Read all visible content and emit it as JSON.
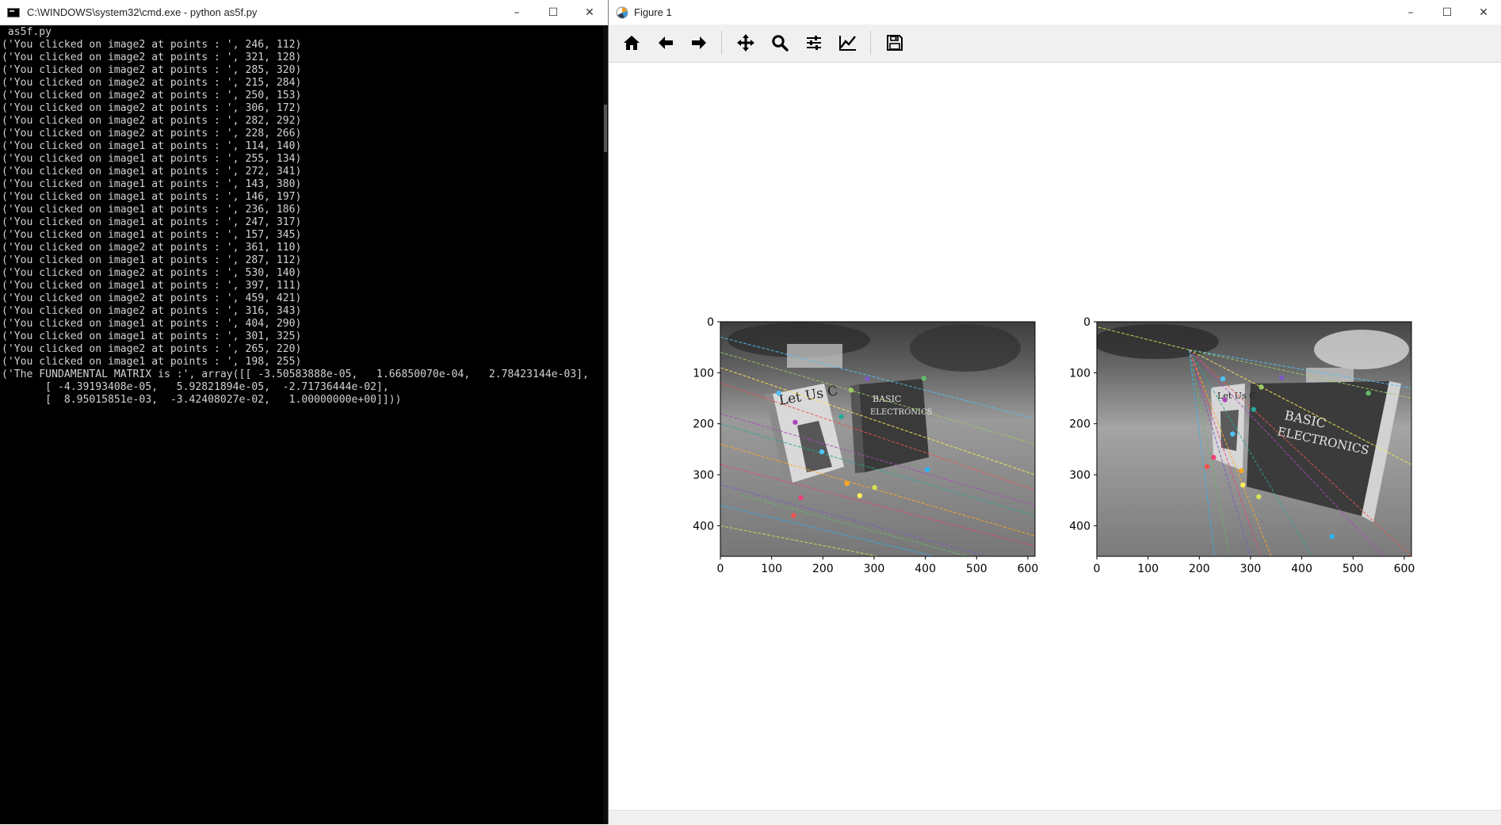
{
  "cmd_window": {
    "title": "C:\\WINDOWS\\system32\\cmd.exe - python  as5f.py",
    "buttons": {
      "minimize": "–",
      "maximize": "☐",
      "close": "✕"
    },
    "lines": [
      " as5f.py",
      "('You clicked on image2 at points : ', 246, 112)",
      "('You clicked on image2 at points : ', 321, 128)",
      "('You clicked on image2 at points : ', 285, 320)",
      "('You clicked on image2 at points : ', 215, 284)",
      "('You clicked on image2 at points : ', 250, 153)",
      "('You clicked on image2 at points : ', 306, 172)",
      "('You clicked on image2 at points : ', 282, 292)",
      "('You clicked on image2 at points : ', 228, 266)",
      "('You clicked on image1 at points : ', 114, 140)",
      "('You clicked on image1 at points : ', 255, 134)",
      "('You clicked on image1 at points : ', 272, 341)",
      "('You clicked on image1 at points : ', 143, 380)",
      "('You clicked on image1 at points : ', 146, 197)",
      "('You clicked on image1 at points : ', 236, 186)",
      "('You clicked on image1 at points : ', 247, 317)",
      "('You clicked on image1 at points : ', 157, 345)",
      "('You clicked on image2 at points : ', 361, 110)",
      "('You clicked on image1 at points : ', 287, 112)",
      "('You clicked on image2 at points : ', 530, 140)",
      "('You clicked on image1 at points : ', 397, 111)",
      "('You clicked on image2 at points : ', 459, 421)",
      "('You clicked on image2 at points : ', 316, 343)",
      "('You clicked on image1 at points : ', 404, 290)",
      "('You clicked on image1 at points : ', 301, 325)",
      "('You clicked on image2 at points : ', 265, 220)",
      "('You clicked on image1 at points : ', 198, 255)",
      "('The FUNDAMENTAL MATRIX is :', array([[ -3.50583888e-05,   1.66850070e-04,   2.78423144e-03],",
      "       [ -4.39193408e-05,   5.92821894e-05,  -2.71736444e-02],",
      "       [  8.95015851e-03,  -3.42408027e-02,   1.00000000e+00]]))"
    ]
  },
  "figure_window": {
    "title": "Figure 1",
    "buttons": {
      "minimize": "–",
      "maximize": "☐",
      "close": "✕"
    },
    "toolbar": [
      {
        "name": "home",
        "icon": "home-icon"
      },
      {
        "name": "back",
        "icon": "arrow-left-icon"
      },
      {
        "name": "forward",
        "icon": "arrow-right-icon"
      },
      {
        "name": "pan",
        "icon": "move-icon"
      },
      {
        "name": "zoom",
        "icon": "magnifier-icon"
      },
      {
        "name": "configure-subplots",
        "icon": "sliders-icon"
      },
      {
        "name": "edit-axes",
        "icon": "line-chart-icon"
      },
      {
        "name": "save",
        "icon": "floppy-disk-icon"
      }
    ],
    "plots": [
      {
        "id": "image1",
        "x_ticks": [
          "0",
          "100",
          "200",
          "300",
          "400",
          "500",
          "600"
        ],
        "y_ticks": [
          "0",
          "100",
          "200",
          "300",
          "400"
        ],
        "xlim": [
          0,
          614
        ],
        "ylim": [
          460,
          0
        ],
        "book_labels": [
          "Let Us C",
          "BASIC",
          "ELECTRONICS"
        ]
      },
      {
        "id": "image2",
        "x_ticks": [
          "0",
          "100",
          "200",
          "300",
          "400",
          "500",
          "600"
        ],
        "y_ticks": [
          "0",
          "100",
          "200",
          "300",
          "400"
        ],
        "xlim": [
          0,
          614
        ],
        "ylim": [
          460,
          0
        ],
        "book_labels": [
          "Let Us C",
          "BASIC",
          "ELECTRONICS"
        ]
      }
    ]
  }
}
